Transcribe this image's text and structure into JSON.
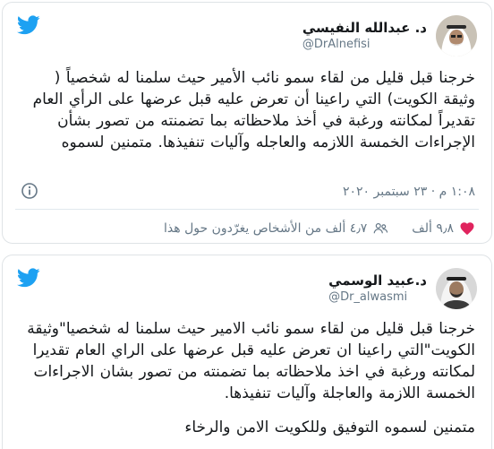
{
  "tweets": [
    {
      "author_name": "د. عبدالله النفيسي",
      "handle": "@DrAlnefisi",
      "text": "خرجنا قبل قليل من لقاء سمو نائب الأمير حيث سلمنا له شخصياً ( وثيقة الكويت) التي راعينا أن تعرض عليه قبل عرضها على الرأي العام تقديراً لمكانته ورغبة في أخذ ملاحظاته بما تضمنته من تصور بشأن الإجراءات  الخمسة اللازمه والعاجله  وآليات تنفيذها. متمنين لسموه",
      "timestamp": "١:٠٨ م · ٢٣ سبتمبر ٢٠٢٠",
      "likes": "٩٫٨ ألف",
      "people_talking": "٤٫٧ ألف من الأشخاص يغرّدون حول هذا",
      "colors": {
        "avatar_bg": "#c9c2b6",
        "headdress": "#ffffff",
        "band": "#2a2a2a"
      }
    },
    {
      "author_name": "د.عبيد الوسمي",
      "handle": "@Dr_alwasmi",
      "text": "خرجنا قبل قليل من لقاء سمو نائب الامير حيث سلمنا له شخصيا\"وثيقة الكويت\"التي راعينا ان تعرض عليه قبل عرضها على الراي العام تقديرا لمكانته ورغبة في اخذ ملاحظاته بما تضمنته من تصور بشان الاجراءات الخمسة اللازمة والعاجلة وآليات تنفيذها.",
      "text_2": "متمنين لسموه التوفيق وللكويت الامن والرخاء",
      "colors": {
        "avatar_bg": "#d8d8d8",
        "headdress": "#f4f4f4",
        "band": "#1e1e1e"
      }
    }
  ],
  "icons": {
    "brand": "twitter-bird-icon",
    "info": "info-icon",
    "like": "heart-icon",
    "people": "people-icon"
  },
  "colors": {
    "brand": "#1da1f2",
    "text": "#14171a",
    "secondary": "#657786",
    "border": "#dfe3e6",
    "like": "#e0245e"
  }
}
